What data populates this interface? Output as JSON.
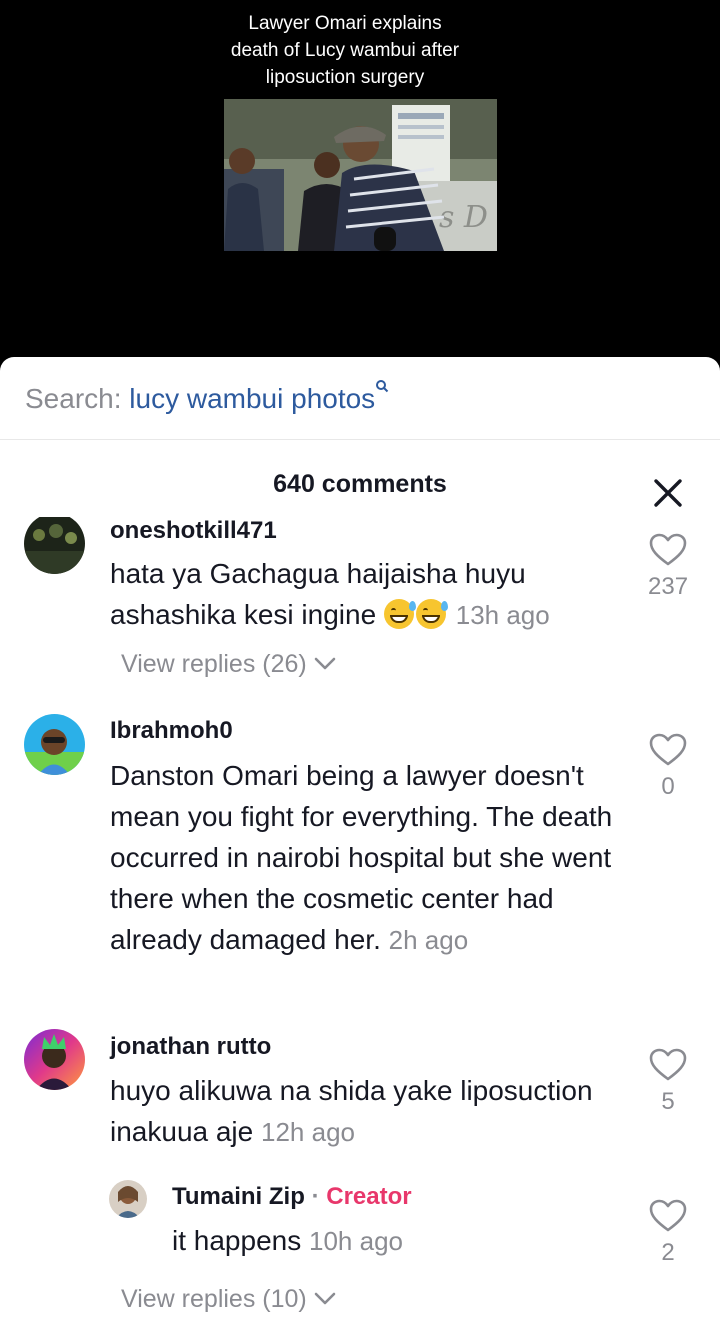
{
  "video": {
    "caption": "Lawyer Omari explains\ndeath of  Lucy wambui after\nliposuction surgery",
    "sign_text": "s D"
  },
  "search": {
    "label": "Search:",
    "query": "lucy wambui photos",
    "icon": "search-icon"
  },
  "header": {
    "title": "640 comments",
    "close_icon": "close-icon"
  },
  "comments": [
    {
      "username": "oneshotkill471",
      "text": "hata ya Gachagua haijaisha huyu ashashika kesi ingine",
      "emoji": "grinning-sweat-emoji x2",
      "time": "13h ago",
      "likes": "237",
      "view_replies": "View replies (26)"
    },
    {
      "username": "Ibrahmoh0",
      "text": "Danston Omari being a lawyer doesn't mean you fight for everything. The death occurred in nairobi hospital but she went there when the cosmetic center had already damaged her.",
      "time": "2h ago",
      "likes": "0"
    },
    {
      "username": "jonathan rutto",
      "text": "huyo alikuwa na shida yake liposuction inakuua aje",
      "time": "12h ago",
      "likes": "5",
      "reply": {
        "username": "Tumaini Zip",
        "separator": "·",
        "badge": "Creator",
        "text": "it happens",
        "time": "10h ago",
        "likes": "2"
      },
      "view_replies": "View replies (10)"
    }
  ],
  "colors": {
    "accent_link": "#2d5a9e",
    "creator": "#e8376b",
    "muted": "#8a8b91",
    "text": "#161823"
  }
}
